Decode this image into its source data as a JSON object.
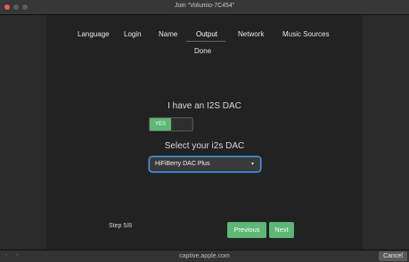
{
  "window": {
    "title": "Join “Volumio-7C454”"
  },
  "tabs": [
    {
      "label": "Language"
    },
    {
      "label": "Login"
    },
    {
      "label": "Name"
    },
    {
      "label": "Output"
    },
    {
      "label": "Network"
    },
    {
      "label": "Music Sources"
    }
  ],
  "done_label": "Done",
  "i2s": {
    "question": "I have an I2S DAC",
    "toggle_on_label": "YES",
    "select_prompt": "Select your i2s DAC",
    "selected_dac": "HiFiBerry DAC Plus"
  },
  "footer": {
    "step": "Step 5/8",
    "previous_label": "Previous",
    "next_label": "Next"
  },
  "bottombar": {
    "nav_arrows": "‹ ›",
    "url": "captive.apple.com",
    "cancel_label": "Cancel"
  },
  "colors": {
    "accent_green": "#5cb874",
    "close_red": "#ee5a52",
    "focus_blue": "#5b9bd5"
  }
}
